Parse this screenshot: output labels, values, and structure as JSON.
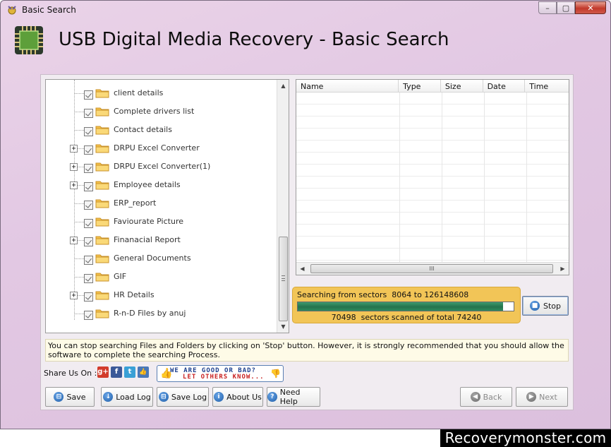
{
  "window": {
    "title": "Basic Search",
    "min": "–",
    "max": "▢",
    "close": "✕"
  },
  "header": {
    "title": "USB Digital Media Recovery - Basic Search"
  },
  "tree": {
    "items": [
      {
        "label": "client details",
        "expandable": false
      },
      {
        "label": "Complete drivers list",
        "expandable": false
      },
      {
        "label": "Contact details",
        "expandable": false
      },
      {
        "label": "DRPU Excel Converter",
        "expandable": true
      },
      {
        "label": "DRPU Excel Converter(1)",
        "expandable": true
      },
      {
        "label": "Employee details",
        "expandable": true
      },
      {
        "label": "ERP_report",
        "expandable": false
      },
      {
        "label": "Faviourate Picture",
        "expandable": false
      },
      {
        "label": "Finanacial Report",
        "expandable": true
      },
      {
        "label": "General Documents",
        "expandable": false
      },
      {
        "label": "GIF",
        "expandable": false
      },
      {
        "label": "HR Details",
        "expandable": true
      },
      {
        "label": "R-n-D Files by anuj",
        "expandable": false
      }
    ],
    "expander_symbol": "+"
  },
  "filelist": {
    "columns": [
      "Name",
      "Type",
      "Size",
      "Date",
      "Time"
    ],
    "scroll_grip": "III"
  },
  "progress": {
    "line1_prefix": "Searching from sectors",
    "from_sector": "8064",
    "to_word": "to",
    "to_sector": "126148608",
    "scanned": "70498",
    "scanned_mid": "sectors scanned of total",
    "total": "74240",
    "fraction": 0.95
  },
  "stop_button": {
    "label": "Stop"
  },
  "info": {
    "text": "You can stop searching Files and Folders by clicking on 'Stop' button. However, it is strongly recommended that you should allow the software to complete the searching Process."
  },
  "share": {
    "label": "Share Us On :",
    "icons": [
      {
        "name": "google-plus-icon",
        "glyph": "g+",
        "color": "#d23b2b"
      },
      {
        "name": "facebook-icon",
        "glyph": "f",
        "color": "#3b5998"
      },
      {
        "name": "twitter-icon",
        "glyph": "t",
        "color": "#3aa0d6"
      },
      {
        "name": "like-icon",
        "glyph": "👍",
        "color": "#4a78b8"
      }
    ],
    "feedback_line1": "WE ARE GOOD OR BAD?",
    "feedback_line2": "LET OTHERS KNOW..."
  },
  "buttons": {
    "save": "Save",
    "load_log": "Load Log",
    "save_log": "Save Log",
    "about_us": "About Us",
    "need_help": "Need Help",
    "back": "Back",
    "next": "Next"
  },
  "watermark": "Recoverymonster.com"
}
